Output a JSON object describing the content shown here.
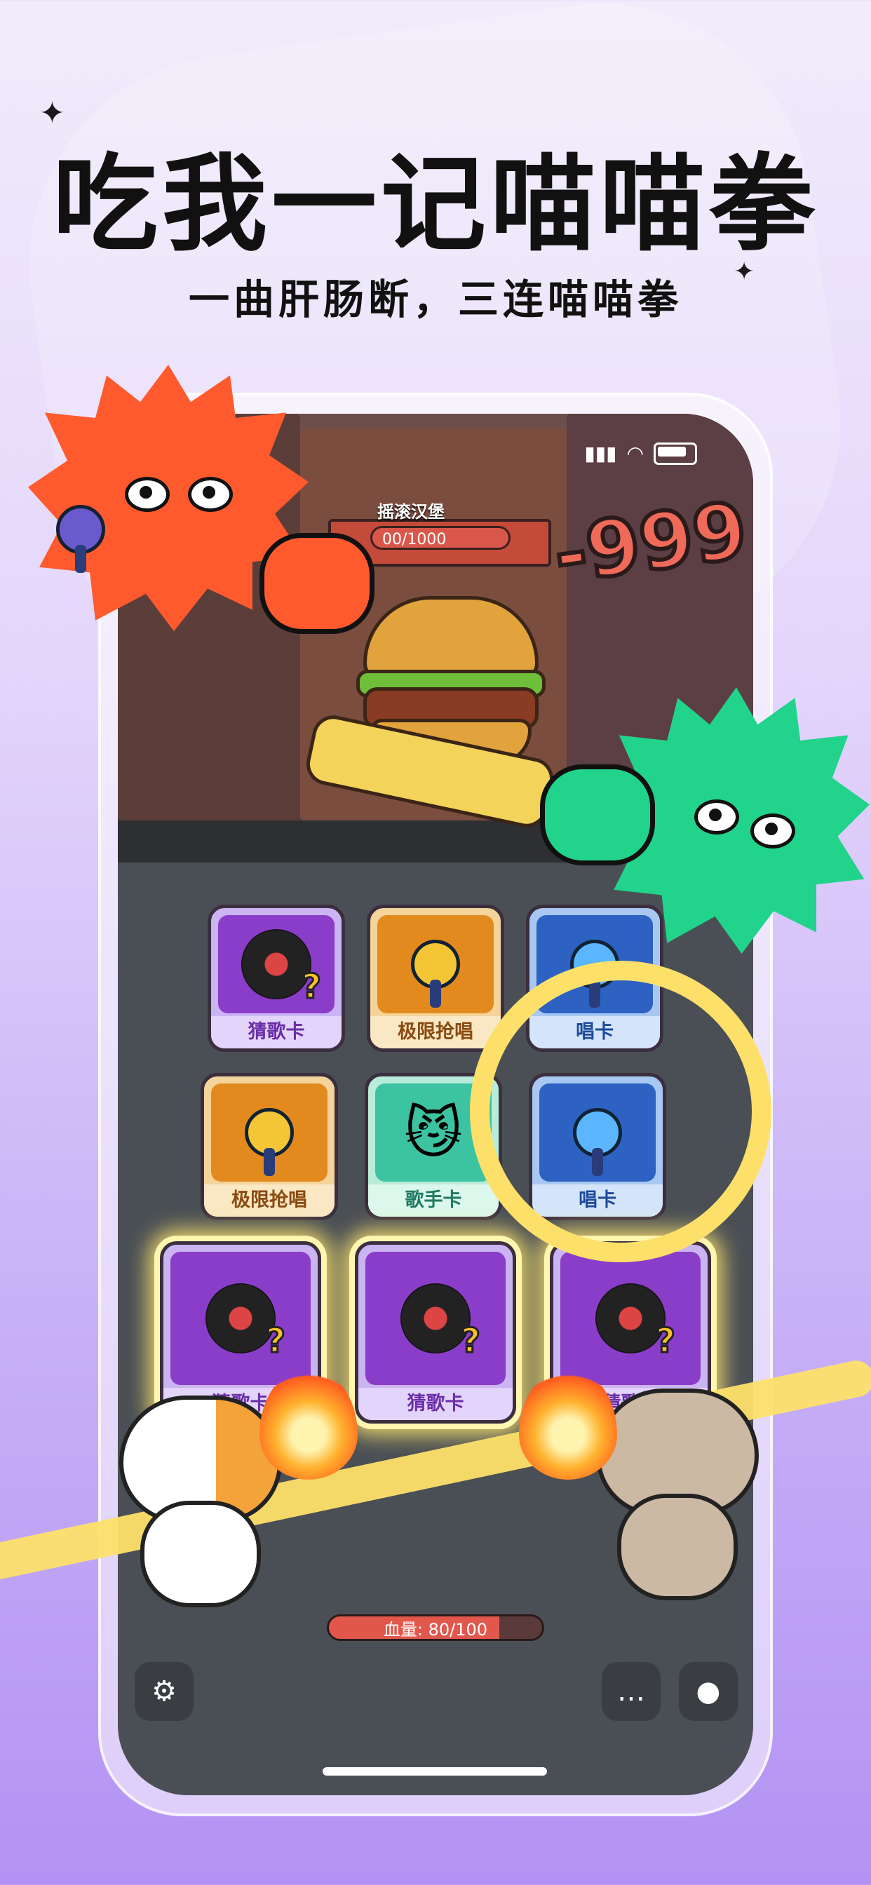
{
  "headline": "吃我一记喵喵拳",
  "subline": "一曲肝肠断，三连喵喵拳",
  "boss": {
    "name": "摇滚汉堡",
    "hp_text": "00/1000"
  },
  "damage": "-999",
  "cards": [
    {
      "label": "猜歌卡",
      "type": "guess",
      "color": "purple"
    },
    {
      "label": "极限抢唱",
      "type": "mic-gold",
      "color": "orange"
    },
    {
      "label": "唱卡",
      "type": "mic-blue",
      "color": "blue"
    },
    {
      "label": "极限抢唱",
      "type": "mic-gold",
      "color": "orange"
    },
    {
      "label": "歌手卡",
      "type": "singer",
      "color": "teal"
    },
    {
      "label": "唱卡",
      "type": "mic-blue",
      "color": "blue"
    },
    {
      "label": "猜歌卡",
      "type": "guess",
      "color": "purple"
    },
    {
      "label": "猜歌卡",
      "type": "guess",
      "color": "purple"
    },
    {
      "label": "猜歌卡",
      "type": "guess",
      "color": "purple"
    }
  ],
  "player_hp": {
    "text": "血量: 80/100",
    "fraction": 0.8
  },
  "controls": {
    "settings_icon": "⚙",
    "chat_icon": "…",
    "mic_icon": "●"
  }
}
